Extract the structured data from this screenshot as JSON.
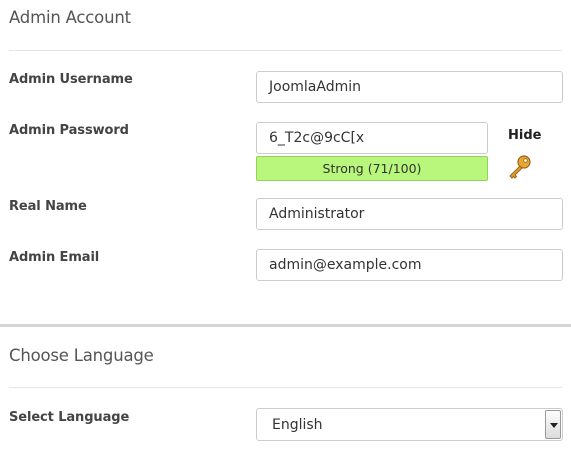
{
  "admin_account": {
    "title": "Admin Account",
    "username": {
      "label": "Admin Username",
      "value": "JoomlaAdmin"
    },
    "password": {
      "label": "Admin Password",
      "value": "6_T2c@9cC[x",
      "hide_label": "Hide",
      "strength_text": "Strong (71/100)",
      "strength_score": 71,
      "strength_color": "#b8f77c"
    },
    "real_name": {
      "label": "Real Name",
      "value": "Administrator"
    },
    "email": {
      "label": "Admin Email",
      "value": "admin@example.com"
    }
  },
  "choose_language": {
    "title": "Choose Language",
    "select": {
      "label": "Select Language",
      "value": "English"
    }
  },
  "icons": {
    "password_generate": "key-icon"
  }
}
